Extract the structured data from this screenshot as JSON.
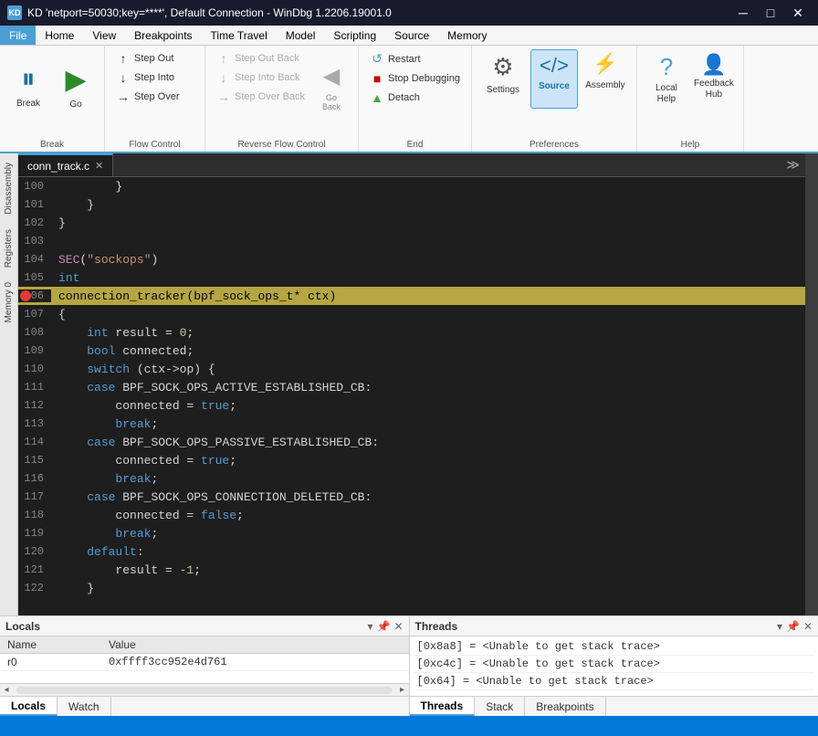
{
  "titleBar": {
    "title": "KD 'netport=50030;key=****', Default Connection  - WinDbg 1.2206.19001.0",
    "icon": "KD",
    "minimize": "─",
    "maximize": "□",
    "close": "✕"
  },
  "menuBar": {
    "items": [
      "File",
      "Home",
      "View",
      "Breakpoints",
      "Time Travel",
      "Model",
      "Scripting",
      "Source",
      "Memory"
    ]
  },
  "ribbon": {
    "groups": {
      "break": {
        "label": "Break",
        "pause_label": "Break",
        "go_label": "Go"
      },
      "flowControl": {
        "label": "Flow Control",
        "stepOut": "Step Out",
        "stepInto": "Step Into",
        "stepOver": "Step Over"
      },
      "reverseFlowControl": {
        "label": "Reverse Flow Control",
        "stepOutBack": "Step Out Back",
        "stepIntoBack": "Step Into Back",
        "stepOverBack": "Step Over Back",
        "goBack_label": "Go\nBack"
      },
      "end": {
        "label": "End",
        "restart": "Restart",
        "stopDebugging": "Stop Debugging",
        "detach": "Detach"
      },
      "preferences": {
        "label": "Preferences",
        "settings": "Settings",
        "source": "Source",
        "assembly": "Assembly"
      },
      "help": {
        "label": "Help",
        "localHelp": "Local\nHelp",
        "feedbackHub": "Feedback\nHub"
      }
    }
  },
  "sidebarLabels": [
    "Disassembly",
    "Registers",
    "Memory 0"
  ],
  "editor": {
    "tabs": [
      {
        "name": "conn_track.c",
        "active": true
      }
    ],
    "lines": [
      {
        "num": 100,
        "content": "        }",
        "highlighted": false,
        "breakpoint": false
      },
      {
        "num": 101,
        "content": "    }",
        "highlighted": false,
        "breakpoint": false
      },
      {
        "num": 102,
        "content": "}",
        "highlighted": false,
        "breakpoint": false
      },
      {
        "num": 103,
        "content": "",
        "highlighted": false,
        "breakpoint": false
      },
      {
        "num": 104,
        "content": "SEC(\"sockops\")",
        "highlighted": false,
        "breakpoint": false
      },
      {
        "num": 105,
        "content": "int",
        "highlighted": false,
        "breakpoint": false
      },
      {
        "num": 106,
        "content": "connection_tracker(bpf_sock_ops_t* ctx)",
        "highlighted": true,
        "breakpoint": true
      },
      {
        "num": 107,
        "content": "{",
        "highlighted": false,
        "breakpoint": false
      },
      {
        "num": 108,
        "content": "    int result = 0;",
        "highlighted": false,
        "breakpoint": false
      },
      {
        "num": 109,
        "content": "    bool connected;",
        "highlighted": false,
        "breakpoint": false
      },
      {
        "num": 110,
        "content": "    switch (ctx->op) {",
        "highlighted": false,
        "breakpoint": false
      },
      {
        "num": 111,
        "content": "    case BPF_SOCK_OPS_ACTIVE_ESTABLISHED_CB:",
        "highlighted": false,
        "breakpoint": false
      },
      {
        "num": 112,
        "content": "        connected = true;",
        "highlighted": false,
        "breakpoint": false
      },
      {
        "num": 113,
        "content": "        break;",
        "highlighted": false,
        "breakpoint": false
      },
      {
        "num": 114,
        "content": "    case BPF_SOCK_OPS_PASSIVE_ESTABLISHED_CB:",
        "highlighted": false,
        "breakpoint": false
      },
      {
        "num": 115,
        "content": "        connected = true;",
        "highlighted": false,
        "breakpoint": false
      },
      {
        "num": 116,
        "content": "        break;",
        "highlighted": false,
        "breakpoint": false
      },
      {
        "num": 117,
        "content": "    case BPF_SOCK_OPS_CONNECTION_DELETED_CB:",
        "highlighted": false,
        "breakpoint": false
      },
      {
        "num": 118,
        "content": "        connected = false;",
        "highlighted": false,
        "breakpoint": false
      },
      {
        "num": 119,
        "content": "        break;",
        "highlighted": false,
        "breakpoint": false
      },
      {
        "num": 120,
        "content": "    default:",
        "highlighted": false,
        "breakpoint": false
      },
      {
        "num": 121,
        "content": "        result = -1;",
        "highlighted": false,
        "breakpoint": false
      },
      {
        "num": 122,
        "content": "    }",
        "highlighted": false,
        "breakpoint": false
      }
    ]
  },
  "bottomPanels": {
    "locals": {
      "title": "Locals",
      "columns": [
        "Name",
        "Value"
      ],
      "rows": [
        {
          "name": "r0",
          "value": "0xffff3cc952e4d761"
        }
      ],
      "tabs": [
        "Locals",
        "Watch"
      ]
    },
    "threads": {
      "title": "Threads",
      "entries": [
        "[0x8a8] = <Unable to get stack trace>",
        "[0xc4c] = <Unable to get stack trace>",
        "[0x64] = <Unable to get stack trace>"
      ],
      "tabs": [
        "Threads",
        "Stack",
        "Breakpoints"
      ]
    }
  },
  "statusBar": {}
}
